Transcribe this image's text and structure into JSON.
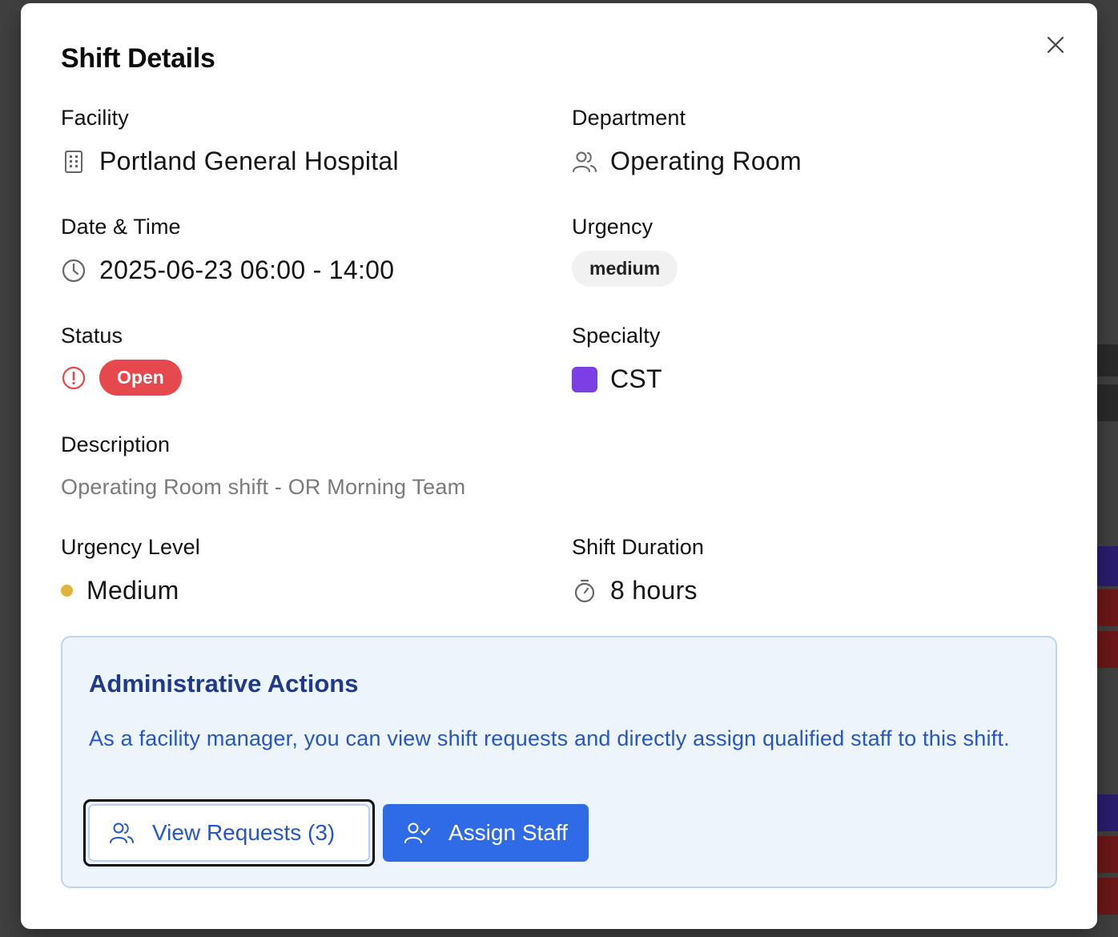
{
  "modal": {
    "title": "Shift Details",
    "close_icon": "close-icon"
  },
  "facility": {
    "label": "Facility",
    "value": "Portland General Hospital",
    "icon": "building-icon"
  },
  "department": {
    "label": "Department",
    "value": "Operating Room",
    "icon": "users-icon"
  },
  "datetime": {
    "label": "Date & Time",
    "value": "2025-06-23 06:00 - 14:00",
    "icon": "clock-icon"
  },
  "urgency": {
    "label": "Urgency",
    "badge": "medium",
    "badge_color": "#f1f1f1"
  },
  "status": {
    "label": "Status",
    "badge": "Open",
    "badge_color": "#e5484d",
    "icon": "alert-circle-icon"
  },
  "specialty": {
    "label": "Specialty",
    "value": "CST",
    "swatch_color": "#7b3fe4"
  },
  "description": {
    "label": "Description",
    "value": "Operating Room shift - OR Morning Team"
  },
  "urgency_level": {
    "label": "Urgency Level",
    "value": "Medium",
    "dot_color": "#e0b43a"
  },
  "shift_duration": {
    "label": "Shift Duration",
    "value": "8 hours",
    "icon": "timer-icon"
  },
  "admin": {
    "title": "Administrative Actions",
    "text": "As a facility manager, you can view shift requests and directly assign qualified staff to this shift.",
    "view_requests_label": "View Requests (3)",
    "assign_staff_label": "Assign Staff",
    "accent_color": "#2f6be6"
  }
}
